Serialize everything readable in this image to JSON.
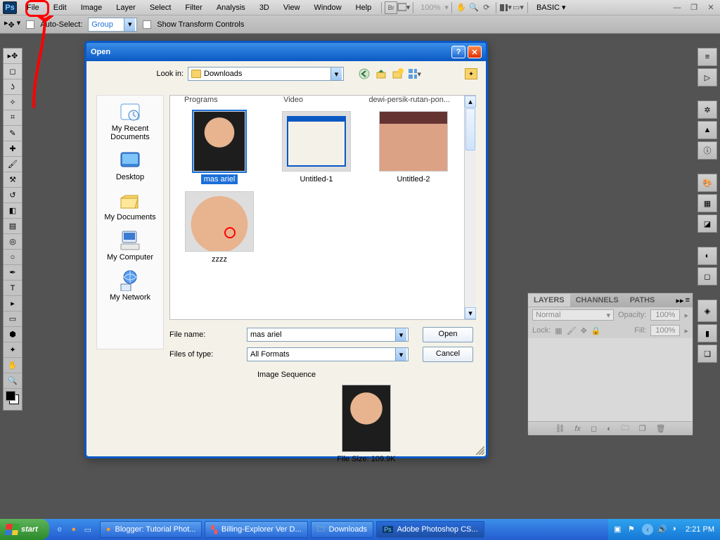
{
  "menu": {
    "items": [
      "File",
      "Edit",
      "Image",
      "Layer",
      "Select",
      "Filter",
      "Analysis",
      "3D",
      "View",
      "Window",
      "Help"
    ],
    "zoom": "100%",
    "workspace": "BASIC"
  },
  "options_bar": {
    "auto_select_label": "Auto-Select:",
    "auto_select_value": "Group",
    "transform_label": "Show Transform Controls"
  },
  "dialog": {
    "title": "Open",
    "lookin_label": "Look in:",
    "lookin_value": "Downloads",
    "truncated_row": [
      "Programs",
      "Video",
      "dewi-persik-rutan-pon..."
    ],
    "files": [
      {
        "name": "mas ariel",
        "selected": true,
        "kind": "photo_person"
      },
      {
        "name": "Untitled-1",
        "selected": false,
        "kind": "screenshot_dialog"
      },
      {
        "name": "Untitled-2",
        "selected": false,
        "kind": "photo_twofaces"
      },
      {
        "name": "zzzz",
        "selected": false,
        "kind": "photo_face_close"
      }
    ],
    "sidebar": [
      "My Recent Documents",
      "Desktop",
      "My Documents",
      "My Computer",
      "My Network"
    ],
    "file_name_label": "File name:",
    "file_name_value": "mas ariel",
    "file_type_label": "Files of type:",
    "file_type_value": "All Formats",
    "open_btn": "Open",
    "cancel_btn": "Cancel",
    "image_sequence_label": "Image Sequence",
    "file_size_label": "File Size:  109.9K"
  },
  "layers_panel": {
    "tabs": [
      "LAYERS",
      "CHANNELS",
      "PATHS"
    ],
    "blend_mode": "Normal",
    "opacity_label": "Opacity:",
    "opacity_value": "100%",
    "lock_label": "Lock:",
    "fill_label": "Fill:",
    "fill_value": "100%"
  },
  "taskbar": {
    "start": "start",
    "tasks": [
      {
        "label": "Blogger: Tutorial Phot...",
        "app": "firefox"
      },
      {
        "label": "Billing-Explorer Ver D...",
        "app": "generic"
      },
      {
        "label": "Downloads",
        "app": "folder"
      },
      {
        "label": "Adobe Photoshop CS...",
        "app": "ps",
        "active": true
      }
    ],
    "clock": "2:21 PM"
  }
}
